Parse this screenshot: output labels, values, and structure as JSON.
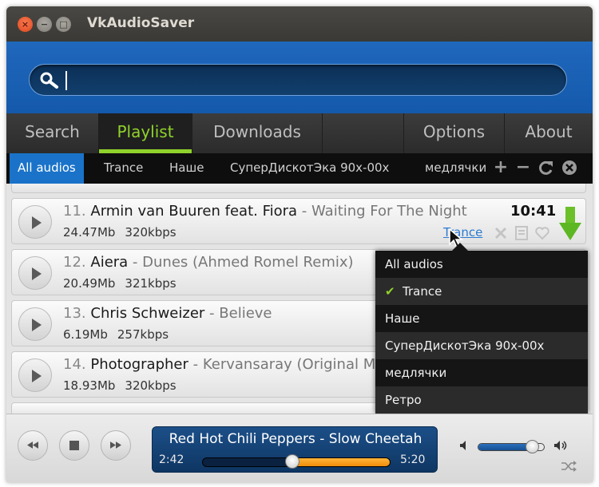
{
  "window": {
    "title": "VkAudioSaver"
  },
  "search": {
    "value": "",
    "placeholder": ""
  },
  "tabs": [
    {
      "label": "Search"
    },
    {
      "label": "Playlist"
    },
    {
      "label": "Downloads"
    },
    {
      "label": "Options"
    },
    {
      "label": "About"
    }
  ],
  "playlists": [
    "All audios",
    "Trance",
    "Наше",
    "СуперДискотЭка 90х-00х",
    "медлячки"
  ],
  "tracks": [
    {
      "num": "11.",
      "artist": "Armin van Buuren feat. Fiora",
      "sep": " - ",
      "title": "Waiting For The Night",
      "size": "24.47Mb",
      "bitrate": "320kbps",
      "duration": "10:41",
      "tag": "Trance"
    },
    {
      "num": "12.",
      "artist": "Aiera",
      "sep": " - ",
      "title": "Dunes (Ahmed Romel Remix)",
      "size": "20.49Mb",
      "bitrate": "321kbps"
    },
    {
      "num": "13.",
      "artist": "Chris Schweizer",
      "sep": " - ",
      "title": "Believe",
      "size": "6.19Mb",
      "bitrate": "257kbps"
    },
    {
      "num": "14.",
      "artist": "Photographer",
      "sep": " - ",
      "title": "Kervansaray (Original Mix)",
      "size": "18.93Mb",
      "bitrate": "320kbps"
    }
  ],
  "dropdown": {
    "items": [
      "All audios",
      "Trance",
      "Наше",
      "СуперДискотЭка 90х-00х",
      "медлячки",
      "Ретро"
    ],
    "checked": 1,
    "check_glyph": "✔"
  },
  "player": {
    "now_playing": "Red Hot Chili Peppers - Slow Cheetah",
    "current_time": "2:42",
    "total_time": "5:20",
    "progress": 0.48,
    "volume": 0.82
  },
  "colors": {
    "accent_green": "#8fd22b",
    "accent_blue": "#1a73c9",
    "progress_orange": "#f08c0a"
  },
  "icons": [
    "search-icon",
    "add-icon",
    "remove-icon",
    "refresh-icon",
    "close-circle-icon",
    "delete-icon",
    "note-icon",
    "heart-icon",
    "download-arrow-icon",
    "rewind-icon",
    "stop-icon",
    "forward-icon",
    "volume-low-icon",
    "volume-high-icon",
    "shuffle-icon",
    "check-icon",
    "cursor-icon"
  ]
}
